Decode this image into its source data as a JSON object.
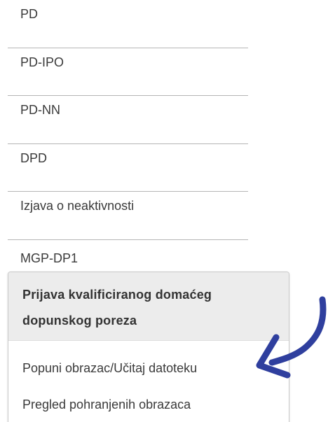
{
  "menu": {
    "items": [
      {
        "label": "PD"
      },
      {
        "label": "PD-IPO"
      },
      {
        "label": "PD-NN"
      },
      {
        "label": "DPD"
      },
      {
        "label": "Izjava o neaktivnosti"
      },
      {
        "label": "MGP-DP1"
      }
    ]
  },
  "dropdown": {
    "title": "Prijava kvalificiranog domaćeg dopunskog poreza",
    "options": [
      {
        "label": "Popuni obrazac/Učitaj datoteku"
      },
      {
        "label": "Pregled pohranjenih obrazaca"
      }
    ]
  },
  "annotation": {
    "arrow_color": "#2f3f9e",
    "icon": "curved-arrow-icon"
  }
}
